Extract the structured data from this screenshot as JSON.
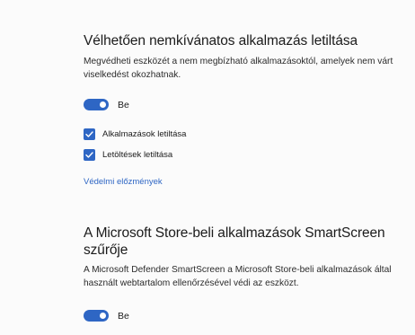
{
  "pua": {
    "title": "Vélhetően nemkívánatos alkalmazás letiltása",
    "description": "Megvédheti eszközét a nem megbízható alkalmazásoktól, amelyek nem várt viselkedést okozhatnak.",
    "toggle_label": "Be",
    "checkboxes": [
      {
        "label": "Alkalmazások letiltása",
        "checked": true
      },
      {
        "label": "Letöltések letiltása",
        "checked": true
      }
    ],
    "link": "Védelmi előzmények"
  },
  "smartscreen": {
    "title": "A Microsoft Store-beli alkalmazások SmartScreen szűrője",
    "description": "A Microsoft Defender SmartScreen a Microsoft Store-beli alkalmazások által használt webtartalom ellenőrzésével védi az eszközt.",
    "toggle_label": "Be"
  },
  "colors": {
    "accent": "#2e66c4",
    "background": "#fbfbfb"
  }
}
